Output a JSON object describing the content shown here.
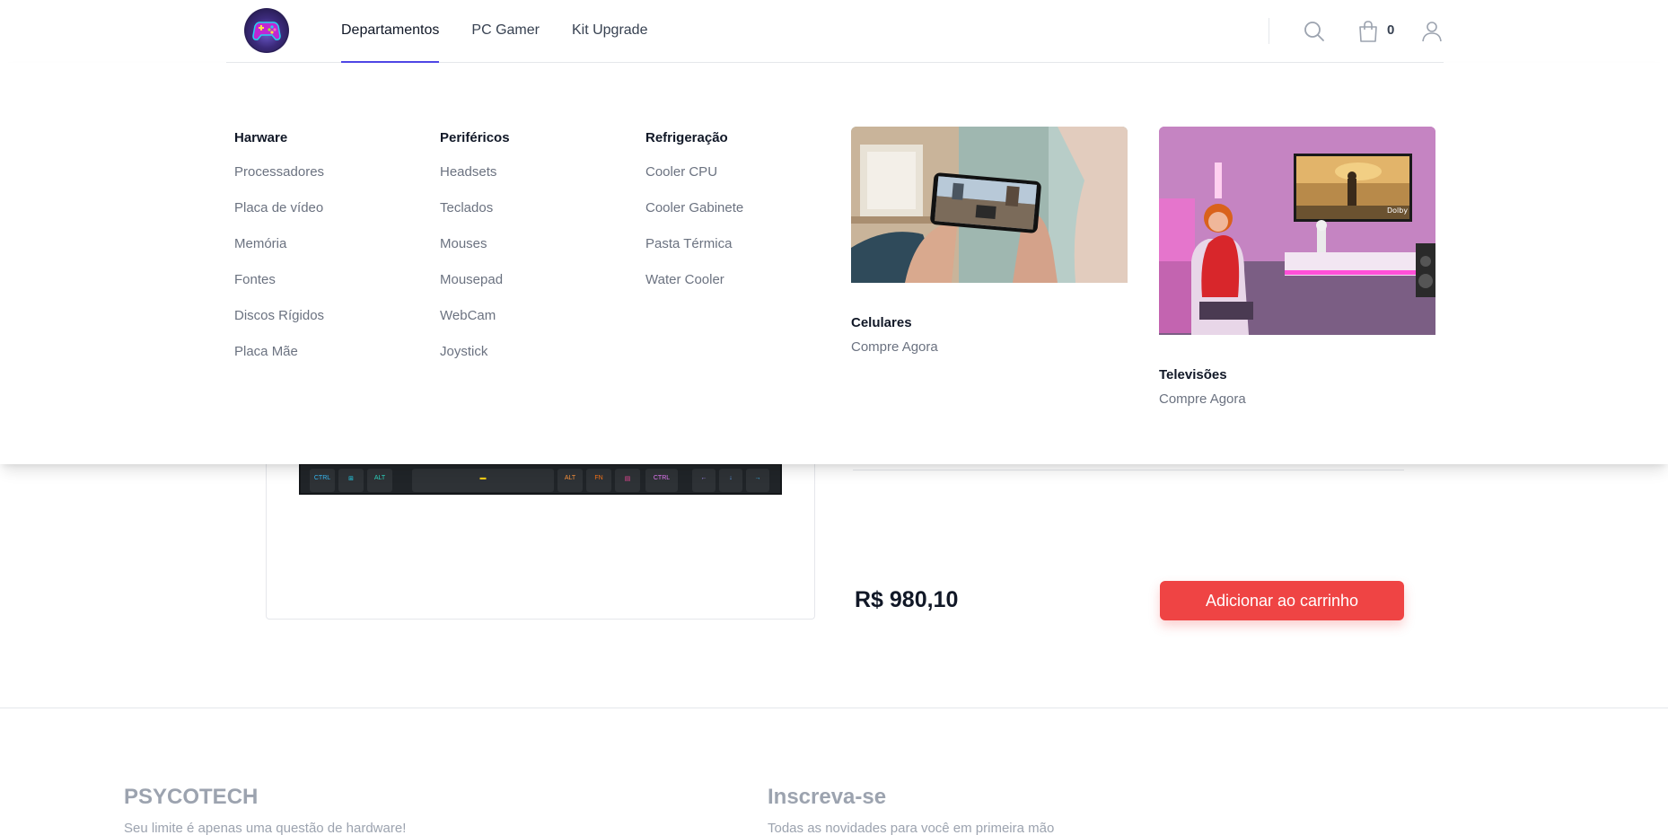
{
  "header": {
    "nav": [
      {
        "label": "Departamentos"
      },
      {
        "label": "PC Gamer"
      },
      {
        "label": "Kit Upgrade"
      }
    ],
    "cart_count": "0",
    "icons": [
      "logo-gamepad-icon",
      "search-icon",
      "shopping-bag-icon",
      "user-icon"
    ]
  },
  "mega_menu": {
    "columns": [
      {
        "title": "Harware",
        "links": [
          "Processadores",
          "Placa de vídeo",
          "Memória",
          "Fontes",
          "Discos Rígidos",
          "Placa Mãe"
        ]
      },
      {
        "title": "Periféricos",
        "links": [
          "Headsets",
          "Teclados",
          "Mouses",
          "Mousepad",
          "WebCam",
          "Joystick"
        ]
      },
      {
        "title": "Refrigeração",
        "links": [
          "Cooler CPU",
          "Cooler Gabinete",
          "Pasta Térmica",
          "Water Cooler"
        ]
      }
    ],
    "features": [
      {
        "title": "Celulares",
        "cta": "Compre Agora"
      },
      {
        "title": "Televisões",
        "cta": "Compre Agora"
      }
    ]
  },
  "product": {
    "price": "R$ 980,10",
    "add_to_cart_label": "Adicionar ao carrinho"
  },
  "footer": {
    "brand": "PSYCOTECH",
    "tagline": "Seu limite é apenas uma questão de hardware!",
    "subscribe_title": "Inscreva-se",
    "subscribe_text": "Todas as novidades para você em primeira mão"
  },
  "colors": {
    "accent": "#4f46e5",
    "cta": "#ef4444",
    "muted_text": "#6b7280"
  }
}
